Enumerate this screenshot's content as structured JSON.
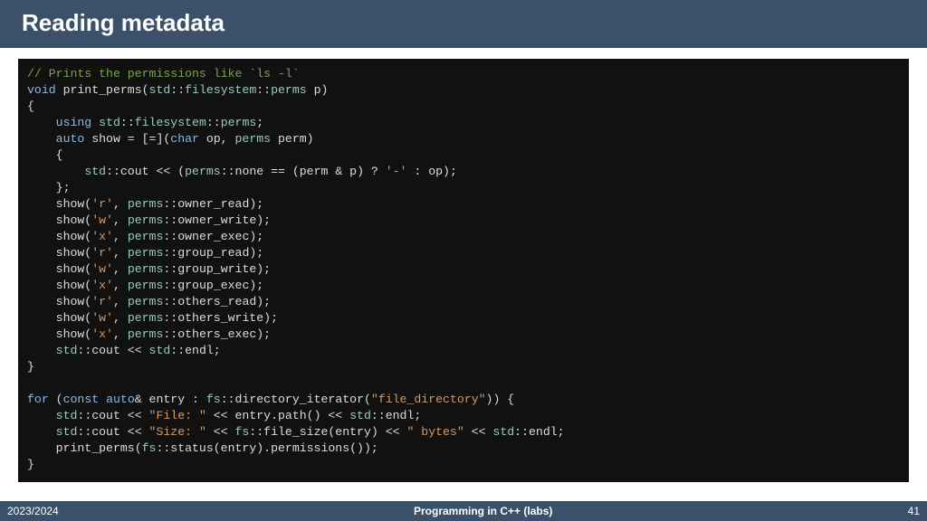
{
  "title": "Reading metadata",
  "footer": {
    "left": "2023/2024",
    "mid": "Programming in C++ (labs)",
    "right": "41"
  },
  "code": {
    "l01a": "// Prints the permissions like `ls -l`",
    "l02a": "void",
    "l02b": " print_perms(",
    "l02c": "std",
    "l02d": "::",
    "l02e": "filesystem",
    "l02f": "::",
    "l02g": "perms",
    "l02h": " p)",
    "l03a": "{",
    "l04a": "    ",
    "l04b": "using",
    "l04c": " ",
    "l04d": "std",
    "l04e": "::",
    "l04f": "filesystem",
    "l04g": "::",
    "l04h": "perms",
    "l04i": ";",
    "l05a": "    ",
    "l05b": "auto",
    "l05c": " show = [=](",
    "l05d": "char",
    "l05e": " op, ",
    "l05f": "perms",
    "l05g": " perm)",
    "l06a": "    {",
    "l07a": "        ",
    "l07b": "std",
    "l07c": "::cout << (",
    "l07d": "perms",
    "l07e": "::none == (perm & p) ? ",
    "l07f": "'-'",
    "l07g": " : op);",
    "l08a": "    };",
    "l09a": "    show(",
    "l09b": "'r'",
    "l09c": ", ",
    "l09d": "perms",
    "l09e": "::owner_read);",
    "l10a": "    show(",
    "l10b": "'w'",
    "l10c": ", ",
    "l10d": "perms",
    "l10e": "::owner_write);",
    "l11a": "    show(",
    "l11b": "'x'",
    "l11c": ", ",
    "l11d": "perms",
    "l11e": "::owner_exec);",
    "l12a": "    show(",
    "l12b": "'r'",
    "l12c": ", ",
    "l12d": "perms",
    "l12e": "::group_read);",
    "l13a": "    show(",
    "l13b": "'w'",
    "l13c": ", ",
    "l13d": "perms",
    "l13e": "::group_write);",
    "l14a": "    show(",
    "l14b": "'x'",
    "l14c": ", ",
    "l14d": "perms",
    "l14e": "::group_exec);",
    "l15a": "    show(",
    "l15b": "'r'",
    "l15c": ", ",
    "l15d": "perms",
    "l15e": "::others_read);",
    "l16a": "    show(",
    "l16b": "'w'",
    "l16c": ", ",
    "l16d": "perms",
    "l16e": "::others_write);",
    "l17a": "    show(",
    "l17b": "'x'",
    "l17c": ", ",
    "l17d": "perms",
    "l17e": "::others_exec);",
    "l18a": "    ",
    "l18b": "std",
    "l18c": "::cout << ",
    "l18d": "std",
    "l18e": "::endl;",
    "l19a": "}",
    "l20a": "",
    "l21a": "for",
    "l21b": " (",
    "l21c": "const",
    "l21d": " ",
    "l21e": "auto",
    "l21f": "& entry : ",
    "l21g": "fs",
    "l21h": "::directory_iterator(",
    "l21i": "\"file_directory\"",
    "l21j": ")) {",
    "l22a": "    ",
    "l22b": "std",
    "l22c": "::cout << ",
    "l22d": "\"File: \"",
    "l22e": " << entry.path() << ",
    "l22f": "std",
    "l22g": "::endl;",
    "l23a": "    ",
    "l23b": "std",
    "l23c": "::cout << ",
    "l23d": "\"Size: \"",
    "l23e": " << ",
    "l23f": "fs",
    "l23g": "::file_size(entry) << ",
    "l23h": "\" bytes\"",
    "l23i": " << ",
    "l23j": "std",
    "l23k": "::endl;",
    "l24a": "    print_perms(",
    "l24b": "fs",
    "l24c": "::status(entry).permissions());",
    "l25a": "}"
  }
}
